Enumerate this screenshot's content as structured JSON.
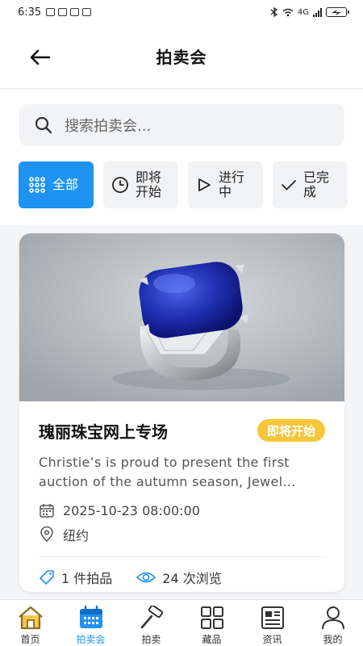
{
  "status_bar": {
    "time": "6:35",
    "battery": "",
    "network": "4G"
  },
  "header": {
    "title": "拍卖会"
  },
  "search": {
    "placeholder": "搜索拍卖会..."
  },
  "filters": [
    {
      "label": "全部",
      "icon": "grid-icon",
      "active": true
    },
    {
      "label": "即将\n开始",
      "icon": "clock-icon",
      "active": false
    },
    {
      "label": "进行\n中",
      "icon": "play-icon",
      "active": false
    },
    {
      "label": "已完\n成",
      "icon": "check-icon",
      "active": false
    }
  ],
  "auction": {
    "title": "瑰丽珠宝网上专场",
    "status": "即将开始",
    "description": "Christie’s is proud to present the first auction of the autumn season, Jewel…",
    "datetime": "2025-10-23 08:00:00",
    "location": "纽约",
    "lots": "1 件拍品",
    "views": "24 次浏览"
  },
  "nav": [
    {
      "label": "首页",
      "icon": "home-icon",
      "active": false
    },
    {
      "label": "拍卖会",
      "icon": "calendar-icon",
      "active": true
    },
    {
      "label": "拍卖",
      "icon": "hammer-icon",
      "active": false
    },
    {
      "label": "藏品",
      "icon": "collection-grid-icon",
      "active": false
    },
    {
      "label": "资讯",
      "icon": "news-icon",
      "active": false
    },
    {
      "label": "我的",
      "icon": "user-icon",
      "active": false
    }
  ],
  "colors": {
    "accent": "#1e93f2",
    "badge": "#f7c63b",
    "card_bg": "#ffffff",
    "page_bg": "#f4f5f7"
  }
}
